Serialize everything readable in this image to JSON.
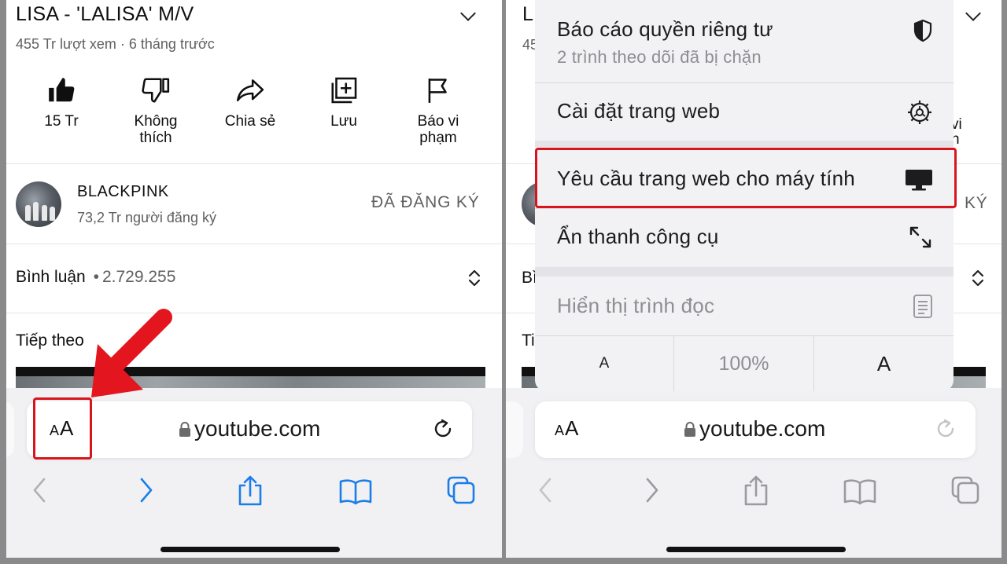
{
  "video": {
    "title": "LISA - 'LALISA' M/V",
    "meta": "455 Tr lượt xem · 6 tháng trước",
    "actions": [
      {
        "icon": "thumbs-up-icon",
        "label": "15 Tr"
      },
      {
        "icon": "thumbs-down-icon",
        "label_line1": "Không",
        "label_line2": "thích"
      },
      {
        "icon": "share-icon",
        "label": "Chia sẻ"
      },
      {
        "icon": "save-playlist-icon",
        "label": "Lưu"
      },
      {
        "icon": "flag-icon",
        "label_line1": "Báo vi",
        "label_line2": "phạm"
      }
    ]
  },
  "channel": {
    "name": "BLACKPINK",
    "subscribers": "73,2 Tr người đăng ký",
    "subscribe_status": "ĐÃ ĐĂNG KÝ"
  },
  "comments": {
    "label": "Bình luận",
    "separator": "•",
    "count": "2.729.255"
  },
  "up_next": {
    "label": "Tiếp theo"
  },
  "safari": {
    "text_size_button": {
      "small": "A",
      "large": "A"
    },
    "domain": "youtube.com",
    "toolbar": [
      "back-icon",
      "forward-icon",
      "share-icon",
      "bookmarks-icon",
      "tabs-icon"
    ]
  },
  "right_partial": {
    "title_fragment": "L",
    "meta_fragment": "45",
    "report_fragment_1": "vi",
    "report_fragment_2": "n",
    "subscribed_fragment": "KÝ",
    "comments_fragment": "Bì",
    "up_next_fragment": "Ti"
  },
  "menu": {
    "privacy_report": {
      "label": "Báo cáo quyền riêng tư",
      "subtitle": "2 trình theo dõi đã bị chặn",
      "icon": "shield-icon"
    },
    "website_settings": {
      "label": "Cài đặt trang web",
      "icon": "gear-icon"
    },
    "request_desktop": {
      "label": "Yêu cầu trang web cho máy tính",
      "icon": "desktop-icon"
    },
    "hide_toolbar": {
      "label": "Ẩn thanh công cụ",
      "icon": "expand-arrows-icon"
    },
    "reader_view": {
      "label": "Hiển thị trình đọc",
      "icon": "reader-icon"
    },
    "font_small": "A",
    "zoom": "100%",
    "font_large": "A"
  },
  "colors": {
    "highlight": "#d8141c",
    "ios_blue": "#1a7ee8",
    "toolbar_gray": "#b0b0b4"
  }
}
